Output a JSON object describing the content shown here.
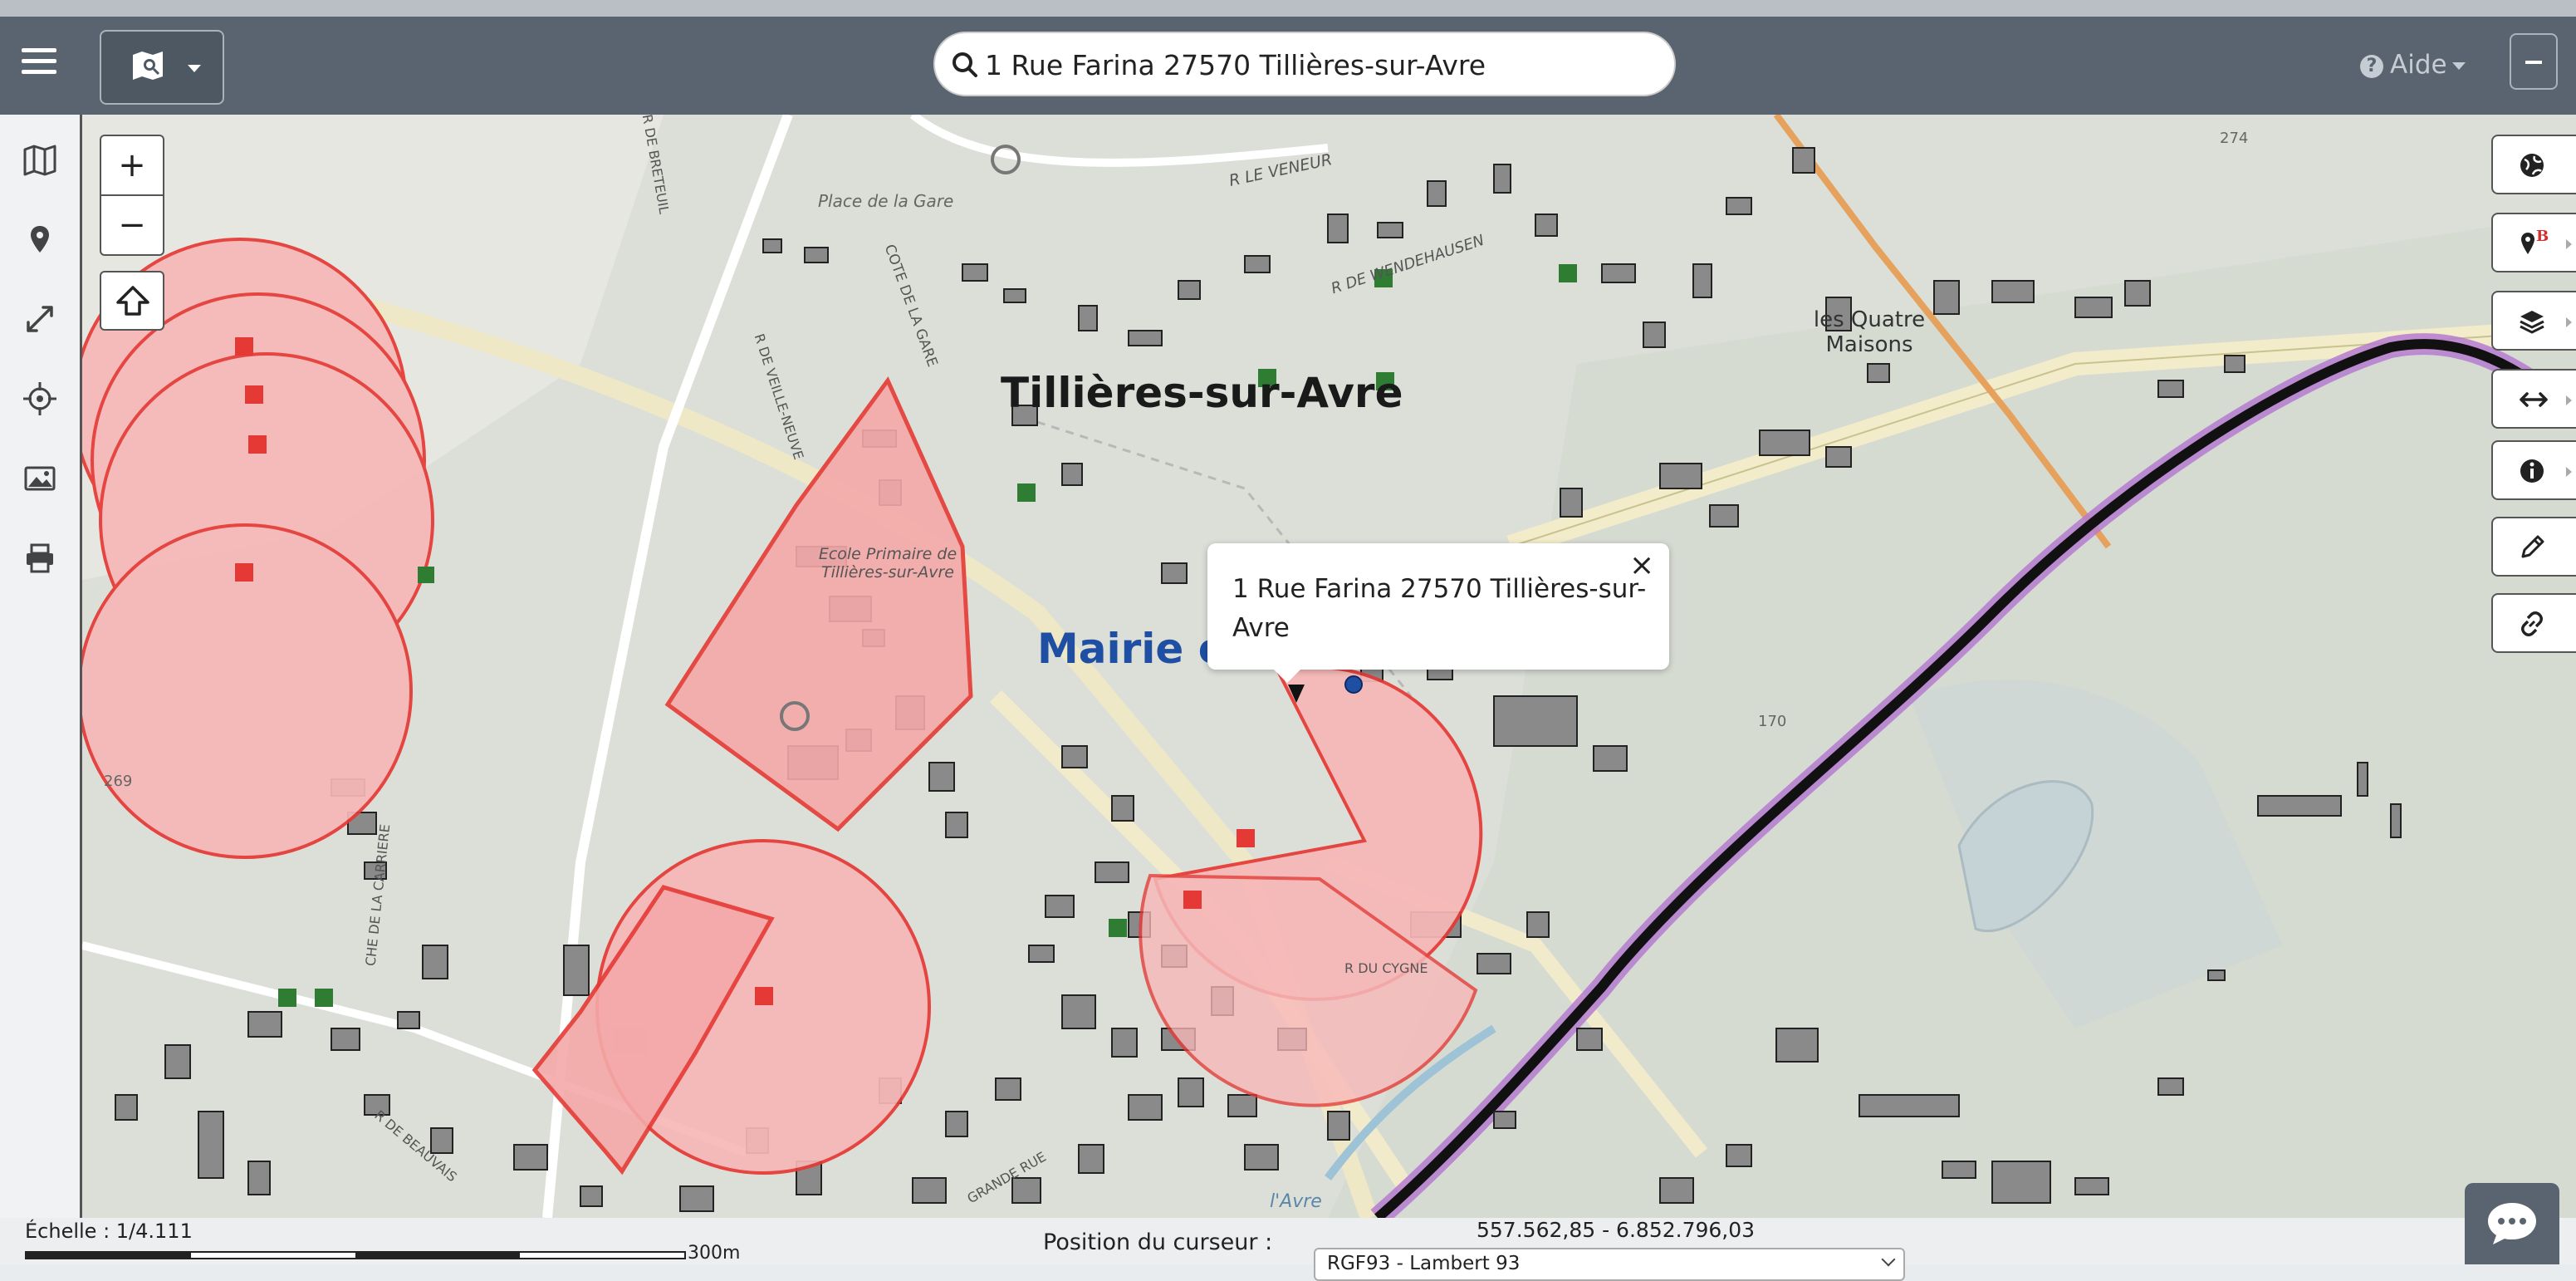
{
  "header": {
    "search_value": "1 Rue Farina 27570 Tillières-sur-Avre",
    "aide_label": "Aide"
  },
  "map": {
    "labels": {
      "town": "Tillières-sur-Avre",
      "mairie": "Mairie c",
      "quatre_maisons": "les Quatre Maisons",
      "place_gare": "Place de la Gare",
      "ecole": "Ecole Primaire de Tillières-sur-Avre",
      "r_le_veneur": "R LE VENEUR",
      "r_wendehausen": "R DE WENDEHAUSEN",
      "cote_gare": "COTE DE LA GARE",
      "r_breteuil": "R DE BRETEUIL",
      "r_veille": "R DE VEILLE-NEUVE",
      "che_carriere": "CHE DE LA CARRIERE",
      "r_beauvais": "R DE BEAUVAIS",
      "r_cygne": "R DU CYGNE",
      "lavre": "l'Avre",
      "grande_rue": "GRANDE RUE",
      "lot_274": "274",
      "lot_170": "170",
      "lot_269": "269"
    },
    "colors": {
      "zone_fill": "#f7b7b7",
      "zone_stroke": "#e53935",
      "marker_red": "#e53935",
      "marker_green": "#2e7d32",
      "river_line": "#111111",
      "river_halo": "#b57bd0"
    }
  },
  "popup": {
    "text": "1 Rue Farina 27570 Tillières-sur-Avre",
    "close": "×"
  },
  "footer": {
    "scale_label": "Échelle : 1/4.111",
    "scale_end": "300m",
    "cursor_label": "Position du curseur :",
    "cursor_value": "557.562,85 - 6.852.796,03",
    "projection": "RGF93 - Lambert 93"
  }
}
